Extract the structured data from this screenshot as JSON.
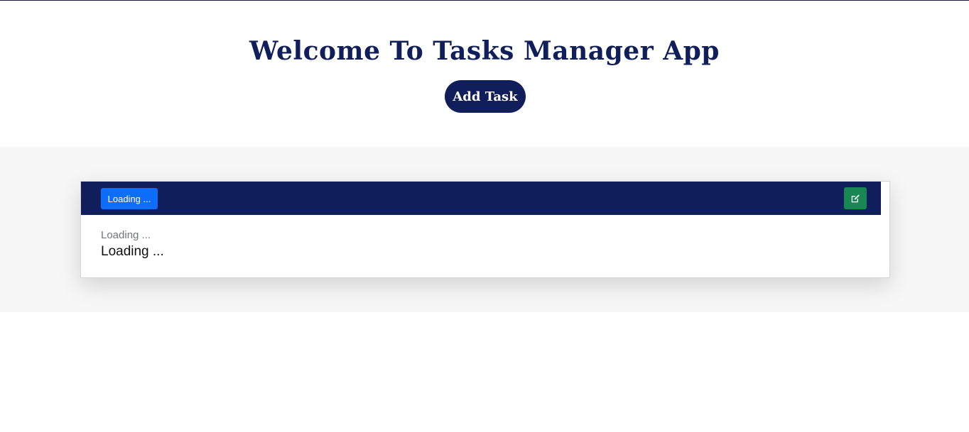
{
  "header": {
    "title": "Welcome To Tasks Manager App",
    "add_button_label": "Add Task"
  },
  "task_card": {
    "status_label": "Loading ...",
    "edit_icon": "edit-icon",
    "subtitle": "Loading ...",
    "description": "Loading ..."
  },
  "colors": {
    "navy": "#101f5c",
    "blue": "#0d6efd",
    "green": "#198754",
    "band_gray": "#f7f7f7"
  }
}
